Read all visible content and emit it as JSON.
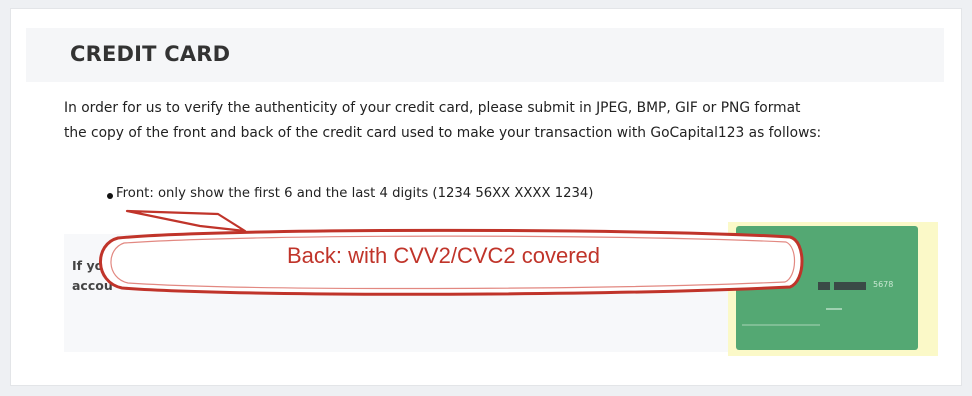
{
  "section": {
    "title": "CREDIT CARD"
  },
  "intro": {
    "line1": "In order for us to verify the authenticity of your credit card, please submit in JPEG, BMP, GIF or PNG format",
    "line2": "the copy of the front and back of the credit card used to make your transaction with GoCapital123 as follows:"
  },
  "bullets": [
    {
      "label": "Front: only show the first 6 and the last 4 digits (1234 56XX XXXX 1234)"
    }
  ],
  "partial_text": {
    "line1": "If you",
    "line2": "accou"
  },
  "card_image": {
    "number_fragment": "5678",
    "background_color": "#54a873",
    "frame_color": "#fbf9c8"
  },
  "callout": {
    "text": "Back: with CVV2/CVC2 covered",
    "color": "#c0342a"
  }
}
